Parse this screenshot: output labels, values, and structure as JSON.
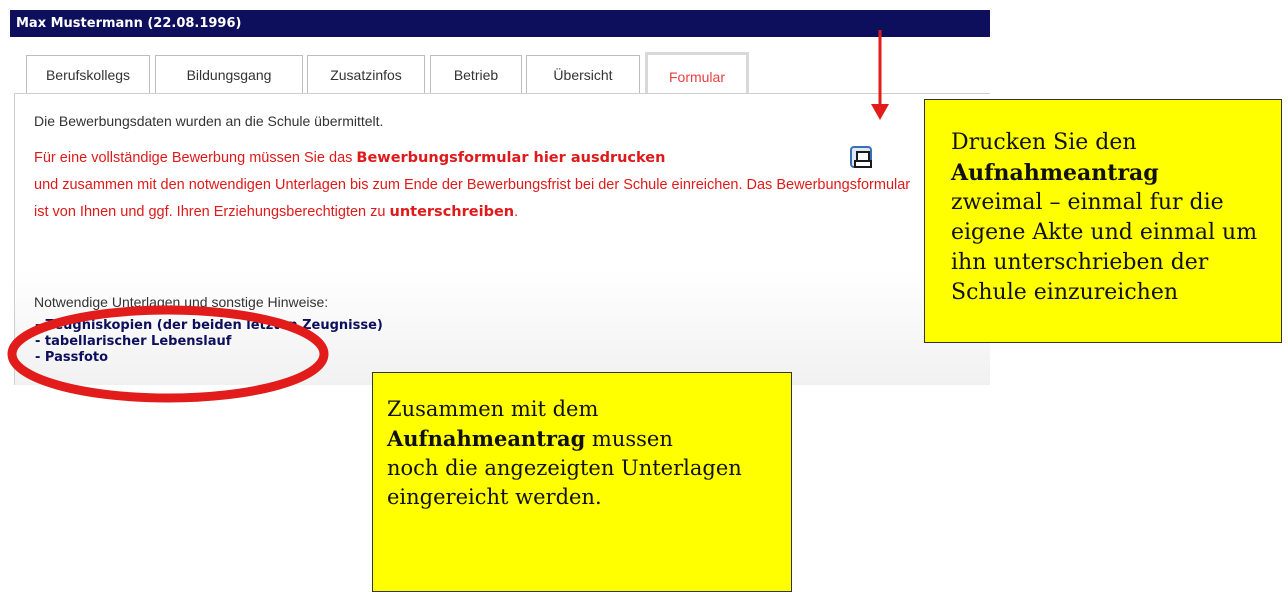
{
  "header": {
    "title": "Max Mustermann (22.08.1996)"
  },
  "tabs": [
    {
      "label": "Berufskollegs",
      "active": false
    },
    {
      "label": "Bildungsgang",
      "active": false
    },
    {
      "label": "Zusatzinfos",
      "active": false
    },
    {
      "label": "Betrieb",
      "active": false
    },
    {
      "label": "Übersicht",
      "active": false
    },
    {
      "label": "Formular",
      "active": true
    }
  ],
  "content": {
    "confirmation": "Die Bewerbungsdaten wurden an die Schule übermittelt.",
    "instruction": {
      "part1": "Für eine vollständige Bewerbung müssen Sie das ",
      "bold1": "Bewerbungsformular hier ausdrucken",
      "part2": "und zusammen mit den notwendigen Unterlagen bis zum Ende der Bewerbungsfrist bei der Schule einreichen. Das Bewerbungsformular ist von Ihnen und ggf. Ihren Erziehungsberechtigten zu",
      "bold2": "unterschreiben",
      "part3": "."
    },
    "print_icon": "printer-icon",
    "docs_heading": "Notwendige Unterlagen und sonstige Hinweise:",
    "docs": [
      "- Zeugniskopien (der beiden letzten Zeugnisse)",
      "- tabellarischer Lebenslauf",
      "- Passfoto"
    ]
  },
  "notes": {
    "right": {
      "line1": "Drucken Sie den",
      "bold": "Aufnahmeantrag",
      "rest": "zweimal – einmal fur die eigene Akte und einmal um ihn unterschrieben der Schule einzureichen"
    },
    "bottom": {
      "line1": "Zusammen mit dem",
      "bold": "Aufnahmeantrag",
      "rest1": " mussen",
      "rest2": "noch die angezeigten Unterlagen eingereicht werden."
    }
  },
  "colors": {
    "header_bg": "#0d0f5c",
    "active_tab": "#e84040",
    "instruction_text": "#e01a1a",
    "note_bg": "#ffff00",
    "annotation_red": "#e21b1b"
  }
}
